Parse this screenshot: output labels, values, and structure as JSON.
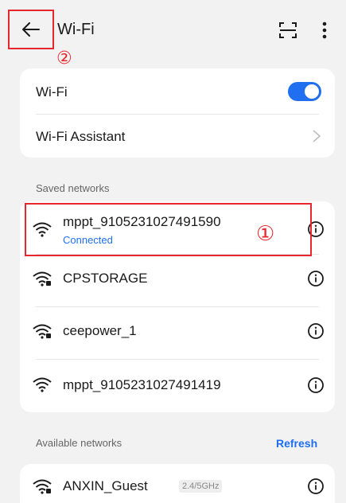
{
  "header": {
    "title": "Wi-Fi",
    "annotation_back": "②"
  },
  "wifi_card": {
    "wifi_label": "Wi-Fi",
    "wifi_enabled": true,
    "assistant_label": "Wi-Fi Assistant"
  },
  "saved": {
    "section_label": "Saved networks",
    "networks": [
      {
        "name": "mppt_9105231027491590",
        "status": "Connected",
        "icon": "wifi-icon"
      },
      {
        "name": "CPSTORAGE",
        "status": "",
        "icon": "wifi-locked-icon"
      },
      {
        "name": "ceepower_1",
        "status": "",
        "icon": "wifi-locked-icon"
      },
      {
        "name": "mppt_9105231027491419",
        "status": "",
        "icon": "wifi-icon"
      }
    ],
    "annotation_connected": "①"
  },
  "available": {
    "section_label": "Available networks",
    "refresh_label": "Refresh",
    "networks": [
      {
        "name": "ANXIN_Guest",
        "band": "2.4/5GHz",
        "icon": "wifi-locked-icon"
      }
    ]
  },
  "colors": {
    "accent": "#1f6ff0",
    "annotation": "#e8262d",
    "background": "#f2f2f2"
  }
}
